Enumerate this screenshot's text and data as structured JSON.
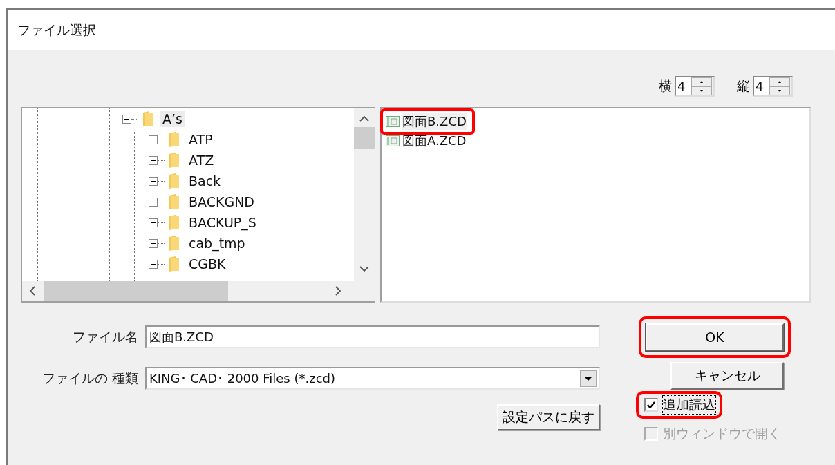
{
  "window": {
    "title": "ファイル選択"
  },
  "grid": [
    {
      "label": "横",
      "value": "4"
    },
    {
      "label": "縦",
      "value": "4"
    }
  ],
  "folder_tree": [
    {
      "name": "A’s",
      "expanded": true,
      "selected": true,
      "children": [
        {
          "name": "ATP",
          "expanded": false,
          "selected": false
        },
        {
          "name": "ATZ",
          "expanded": false,
          "selected": false
        },
        {
          "name": "Back",
          "expanded": false,
          "selected": false
        },
        {
          "name": "BACKGND",
          "expanded": false,
          "selected": false
        },
        {
          "name": "BACKUP_S",
          "expanded": false,
          "selected": false
        },
        {
          "name": "cab_tmp",
          "expanded": false,
          "selected": false
        },
        {
          "name": "CGBK",
          "expanded": false,
          "selected": false
        }
      ]
    }
  ],
  "files": [
    {
      "name": "図面B.ZCD",
      "selected": true,
      "highlighted": true
    },
    {
      "name": "図面A.ZCD",
      "selected": false,
      "highlighted": false
    }
  ],
  "file_name": {
    "label": "ファイル名",
    "value": "図面B.ZCD"
  },
  "file_type": {
    "label": "ファイルの 種類",
    "value": "KING･ CAD･ 2000 Files (*.zcd)"
  },
  "reset_path_button": "設定パスに戻す",
  "ok_button": {
    "label": "OK",
    "highlighted": true
  },
  "cancel_button": "キャンセル",
  "options": [
    {
      "label": "追加読込",
      "checked": true,
      "disabled": false,
      "highlighted": true
    },
    {
      "label": "別ウィンドウで開く",
      "checked": false,
      "disabled": true,
      "highlighted": false
    }
  ]
}
